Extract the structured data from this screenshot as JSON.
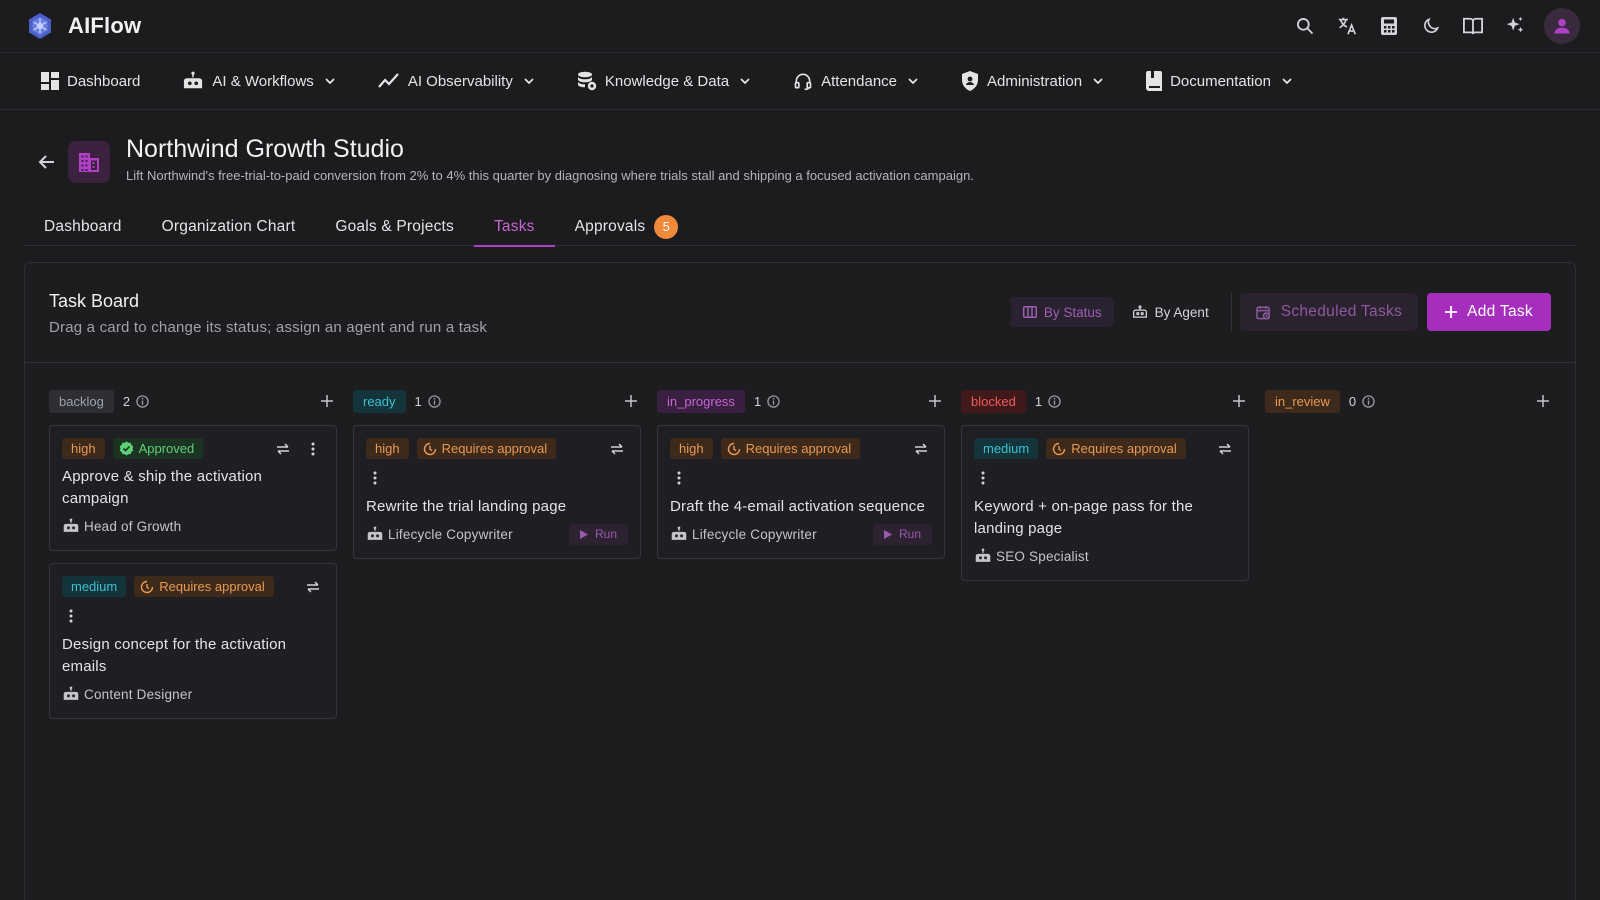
{
  "app": {
    "title": "AIFlow"
  },
  "nav": {
    "items": [
      {
        "label": "Dashboard",
        "icon": "grid-icon"
      },
      {
        "label": "AI & Workflows",
        "icon": "robot-icon"
      },
      {
        "label": "AI Observability",
        "icon": "trend-icon"
      },
      {
        "label": "Knowledge & Data",
        "icon": "database-icon"
      },
      {
        "label": "Attendance",
        "icon": "headset-icon"
      },
      {
        "label": "Administration",
        "icon": "shield-icon"
      },
      {
        "label": "Documentation",
        "icon": "book-icon"
      }
    ]
  },
  "org": {
    "title": "Northwind Growth Studio",
    "description": "Lift Northwind's free-trial-to-paid conversion from 2% to 4% this quarter by diagnosing where trials stall and shipping a focused activation campaign."
  },
  "tabs": [
    {
      "label": "Dashboard"
    },
    {
      "label": "Organization Chart"
    },
    {
      "label": "Goals & Projects"
    },
    {
      "label": "Tasks"
    },
    {
      "label": "Approvals",
      "badge": "5"
    }
  ],
  "board": {
    "title": "Task Board",
    "subtitle": "Drag a card to change its status; assign an agent and run a task",
    "by_status": "By Status",
    "by_agent": "By Agent",
    "scheduled": "Scheduled Tasks",
    "add_task": "Add Task"
  },
  "columns": [
    {
      "status": "backlog",
      "count": "2",
      "cards": [
        {
          "priority": "high",
          "approval": "Approved",
          "title": "Approve & ship the activation campaign",
          "agent": "Head of Growth"
        },
        {
          "priority": "medium",
          "approval": "Requires approval",
          "title": "Design concept for the activation emails",
          "agent": "Content Designer"
        }
      ]
    },
    {
      "status": "ready",
      "count": "1",
      "cards": [
        {
          "priority": "high",
          "approval": "Requires approval",
          "title": "Rewrite the trial landing page",
          "agent": "Lifecycle Copywriter",
          "run": "Run"
        }
      ]
    },
    {
      "status": "in_progress",
      "count": "1",
      "cards": [
        {
          "priority": "high",
          "approval": "Requires approval",
          "title": "Draft the 4-email activation sequence",
          "agent": "Lifecycle Copywriter",
          "run": "Run"
        }
      ]
    },
    {
      "status": "blocked",
      "count": "1",
      "cards": [
        {
          "priority": "medium",
          "approval": "Requires approval",
          "title": "Keyword + on-page pass for the landing page",
          "agent": "SEO Specialist"
        }
      ]
    },
    {
      "status": "in_review",
      "count": "0",
      "cards": []
    }
  ],
  "colors": {
    "accent": "#a52ebd",
    "high": "#e89a53",
    "medium": "#3cc2d0",
    "approved": "#5fd07a",
    "backlog": "#9ca3af",
    "ready": "#3cc2d0",
    "in_progress": "#c865d6",
    "blocked": "#f05a5a",
    "in_review": "#e89a53"
  }
}
